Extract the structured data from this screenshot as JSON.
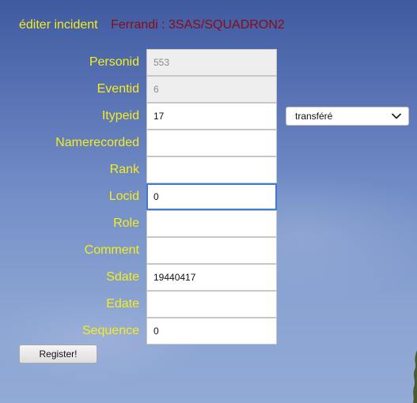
{
  "header": {
    "title": "éditer incident",
    "subtitle": "Ferrandi : 3SAS/SQUADRON2"
  },
  "form": {
    "fields": [
      {
        "label": "Personid",
        "value": "553",
        "readonly": true
      },
      {
        "label": "Eventid",
        "value": "6",
        "readonly": true
      },
      {
        "label": "Itypeid",
        "value": "17"
      },
      {
        "label": "Namerecorded",
        "value": ""
      },
      {
        "label": "Rank",
        "value": ""
      },
      {
        "label": "Locid",
        "value": "0",
        "focused": true
      },
      {
        "label": "Role",
        "value": ""
      },
      {
        "label": "Comment",
        "value": ""
      },
      {
        "label": "Sdate",
        "value": "19440417"
      },
      {
        "label": "Edate",
        "value": ""
      },
      {
        "label": "Sequence",
        "value": "0"
      }
    ],
    "itype_select": {
      "selected": "transféré",
      "icon": "chevron-down-icon"
    },
    "submit_label": "Register!"
  },
  "colors": {
    "label": "#f5ee1c",
    "subtitle": "#8b0a14",
    "focus_border": "#3d7bd6"
  }
}
